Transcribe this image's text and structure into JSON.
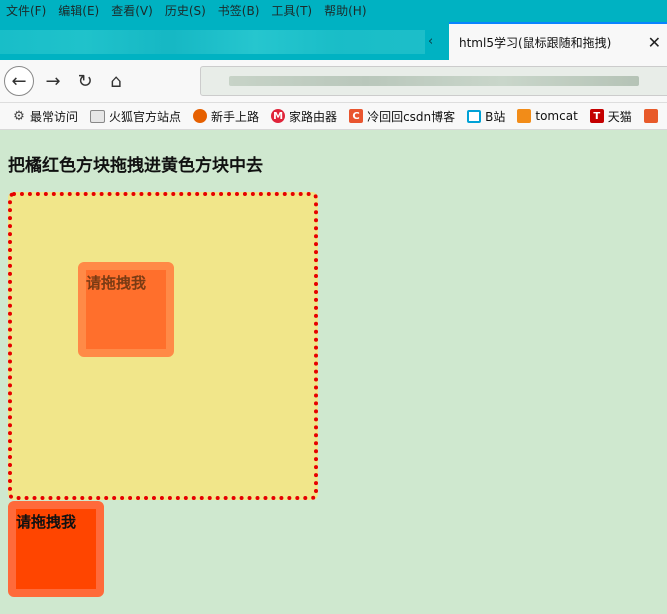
{
  "menu": [
    "文件(F)",
    "编辑(E)",
    "查看(V)",
    "历史(S)",
    "书签(B)",
    "工具(T)",
    "帮助(H)"
  ],
  "tab": {
    "title": "html5学习(鼠标跟随和拖拽)",
    "close": "✕",
    "scroll_left": "‹"
  },
  "nav": {
    "back": "←",
    "forward": "→",
    "reload": "↻",
    "home": "⌂"
  },
  "bookmarks": [
    {
      "label": "最常访问",
      "icon": "gear-icon",
      "color": "#555555"
    },
    {
      "label": "火狐官方站点",
      "icon": "folder-icon",
      "color": "#9a9a9a"
    },
    {
      "label": "新手上路",
      "icon": "firefox-icon",
      "color": "#e66000"
    },
    {
      "label": "家路由器",
      "icon": "router-icon",
      "color": "#e0243a"
    },
    {
      "label": "冷回回csdn博客",
      "icon": "csdn-icon",
      "color": "#e9552f"
    },
    {
      "label": "B站",
      "icon": "bilibili-icon",
      "color": "#00a1d6"
    },
    {
      "label": "tomcat",
      "icon": "tomcat-icon",
      "color": "#f28c18"
    },
    {
      "label": "天猫",
      "icon": "tmall-icon",
      "color": "#c40000"
    },
    {
      "label": "",
      "icon": "extra-icon",
      "color": "#e85a2a"
    }
  ],
  "page": {
    "heading": "把橘红色方块拖拽进黄色方块中去",
    "drag_item_1": "请拖拽我",
    "drag_item_2": "请拖拽我"
  },
  "colors": {
    "page_bg": "#cfe8cf",
    "dropzone_bg": "#f1e68a",
    "dropzone_border": "#e60000",
    "drag1": "#ff6f2c",
    "drag2": "#ff4500"
  }
}
